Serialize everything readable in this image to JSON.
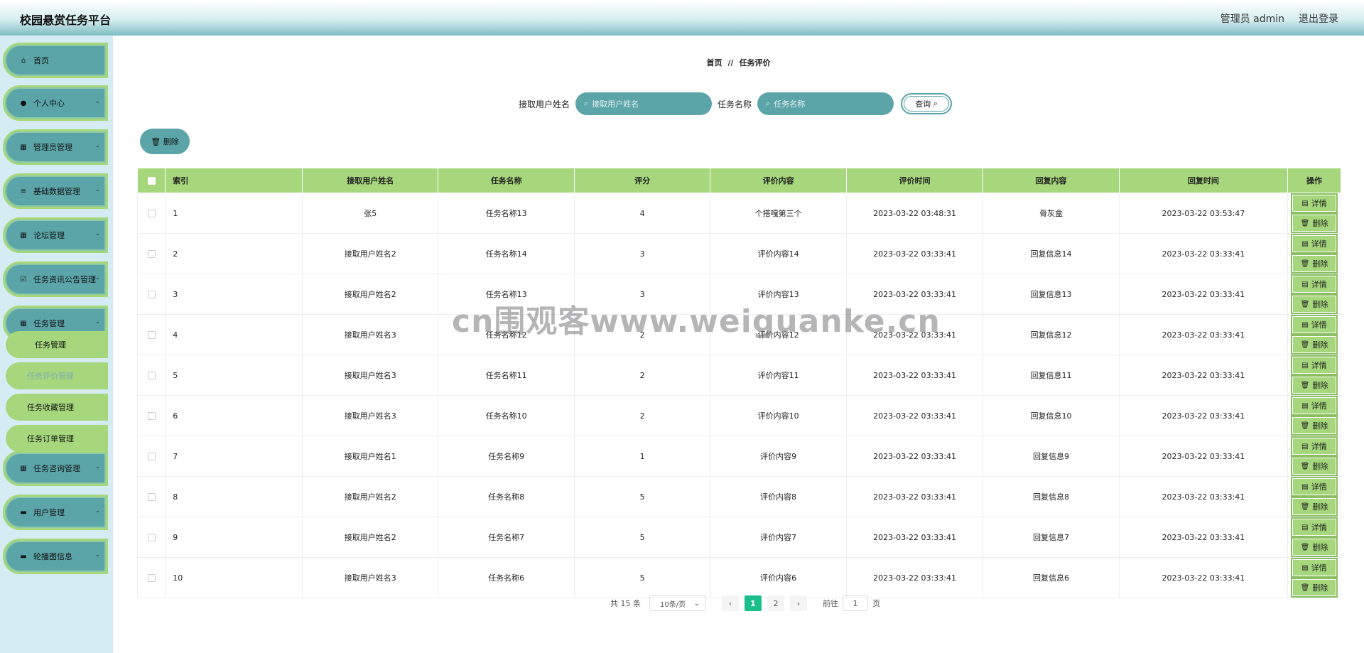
{
  "header": {
    "title": "校园悬赏任务平台",
    "user_label": "管理员 admin",
    "logout_label": "退出登录"
  },
  "sidebar": {
    "items": [
      {
        "label": "首页",
        "icon": "home-icon",
        "glyph": "⌂",
        "chevron": false
      },
      {
        "label": "个人中心",
        "icon": "user-icon",
        "glyph": "●",
        "chevron": true
      },
      {
        "label": "管理员管理",
        "icon": "grid-icon",
        "glyph": "▦",
        "chevron": true
      },
      {
        "label": "基础数据管理",
        "icon": "list-icon",
        "glyph": "≡",
        "chevron": true
      },
      {
        "label": "论坛管理",
        "icon": "grid-icon",
        "glyph": "▦",
        "chevron": true
      },
      {
        "label": "任务资讯公告管理",
        "icon": "check-square-icon",
        "glyph": "☑",
        "chevron": true
      },
      {
        "label": "任务管理",
        "icon": "grid-icon",
        "glyph": "▦",
        "chevron": true
      },
      {
        "label": "任务咨询管理",
        "icon": "table-icon",
        "glyph": "▦",
        "chevron": true
      },
      {
        "label": "用户管理",
        "icon": "monitor-icon",
        "glyph": "▬",
        "chevron": true
      },
      {
        "label": "轮播图信息",
        "icon": "monitor-icon",
        "glyph": "▬",
        "chevron": true
      }
    ],
    "sub_items": [
      {
        "label": "任务管理",
        "active": false
      },
      {
        "label": "任务评价管理",
        "active": true
      },
      {
        "label": "任务收藏管理",
        "active": false
      },
      {
        "label": "任务订单管理",
        "active": false
      }
    ]
  },
  "breadcrumb": {
    "home": "首页",
    "separator": "//",
    "current": "任务评价"
  },
  "search": {
    "user_label": "接取用户姓名",
    "user_placeholder": "接取用户姓名",
    "task_label": "任务名称",
    "task_placeholder": "任务名称",
    "query_label": "查询"
  },
  "toolbar": {
    "delete_label": "删除"
  },
  "table": {
    "columns": [
      "索引",
      "接取用户姓名",
      "任务名称",
      "评分",
      "评价内容",
      "评价时间",
      "回复内容",
      "回复时间",
      "操作"
    ],
    "detail_label": "详情",
    "delete_label": "删除",
    "rows": [
      [
        "1",
        "张5",
        "任务名称13",
        "4",
        "个搭嘎第三个",
        "2023-03-22 03:48:31",
        "骨灰盒",
        "2023-03-22 03:53:47"
      ],
      [
        "2",
        "接取用户姓名2",
        "任务名称14",
        "3",
        "评价内容14",
        "2023-03-22 03:33:41",
        "回复信息14",
        "2023-03-22 03:33:41"
      ],
      [
        "3",
        "接取用户姓名2",
        "任务名称13",
        "3",
        "评价内容13",
        "2023-03-22 03:33:41",
        "回复信息13",
        "2023-03-22 03:33:41"
      ],
      [
        "4",
        "接取用户姓名3",
        "任务名称12",
        "2",
        "评价内容12",
        "2023-03-22 03:33:41",
        "回复信息12",
        "2023-03-22 03:33:41"
      ],
      [
        "5",
        "接取用户姓名3",
        "任务名称11",
        "2",
        "评价内容11",
        "2023-03-22 03:33:41",
        "回复信息11",
        "2023-03-22 03:33:41"
      ],
      [
        "6",
        "接取用户姓名3",
        "任务名称10",
        "2",
        "评价内容10",
        "2023-03-22 03:33:41",
        "回复信息10",
        "2023-03-22 03:33:41"
      ],
      [
        "7",
        "接取用户姓名1",
        "任务名称9",
        "1",
        "评价内容9",
        "2023-03-22 03:33:41",
        "回复信息9",
        "2023-03-22 03:33:41"
      ],
      [
        "8",
        "接取用户姓名2",
        "任务名称8",
        "5",
        "评价内容8",
        "2023-03-22 03:33:41",
        "回复信息8",
        "2023-03-22 03:33:41"
      ],
      [
        "9",
        "接取用户姓名2",
        "任务名称7",
        "5",
        "评价内容7",
        "2023-03-22 03:33:41",
        "回复信息7",
        "2023-03-22 03:33:41"
      ],
      [
        "10",
        "接取用户姓名3",
        "任务名称6",
        "5",
        "评价内容6",
        "2023-03-22 03:33:41",
        "回复信息6",
        "2023-03-22 03:33:41"
      ]
    ]
  },
  "pagination": {
    "total": "共 15 条",
    "page_size": "10条/页",
    "pages": [
      "1",
      "2"
    ],
    "current": "1",
    "goto_prefix": "前往",
    "goto_value": "1",
    "goto_suffix": "页"
  },
  "watermark": "cn围观客www.weiguanke.cn",
  "colors": {
    "teal": "#5ba5a8",
    "green": "#a6d77c",
    "active_page": "#1cbf8c"
  }
}
